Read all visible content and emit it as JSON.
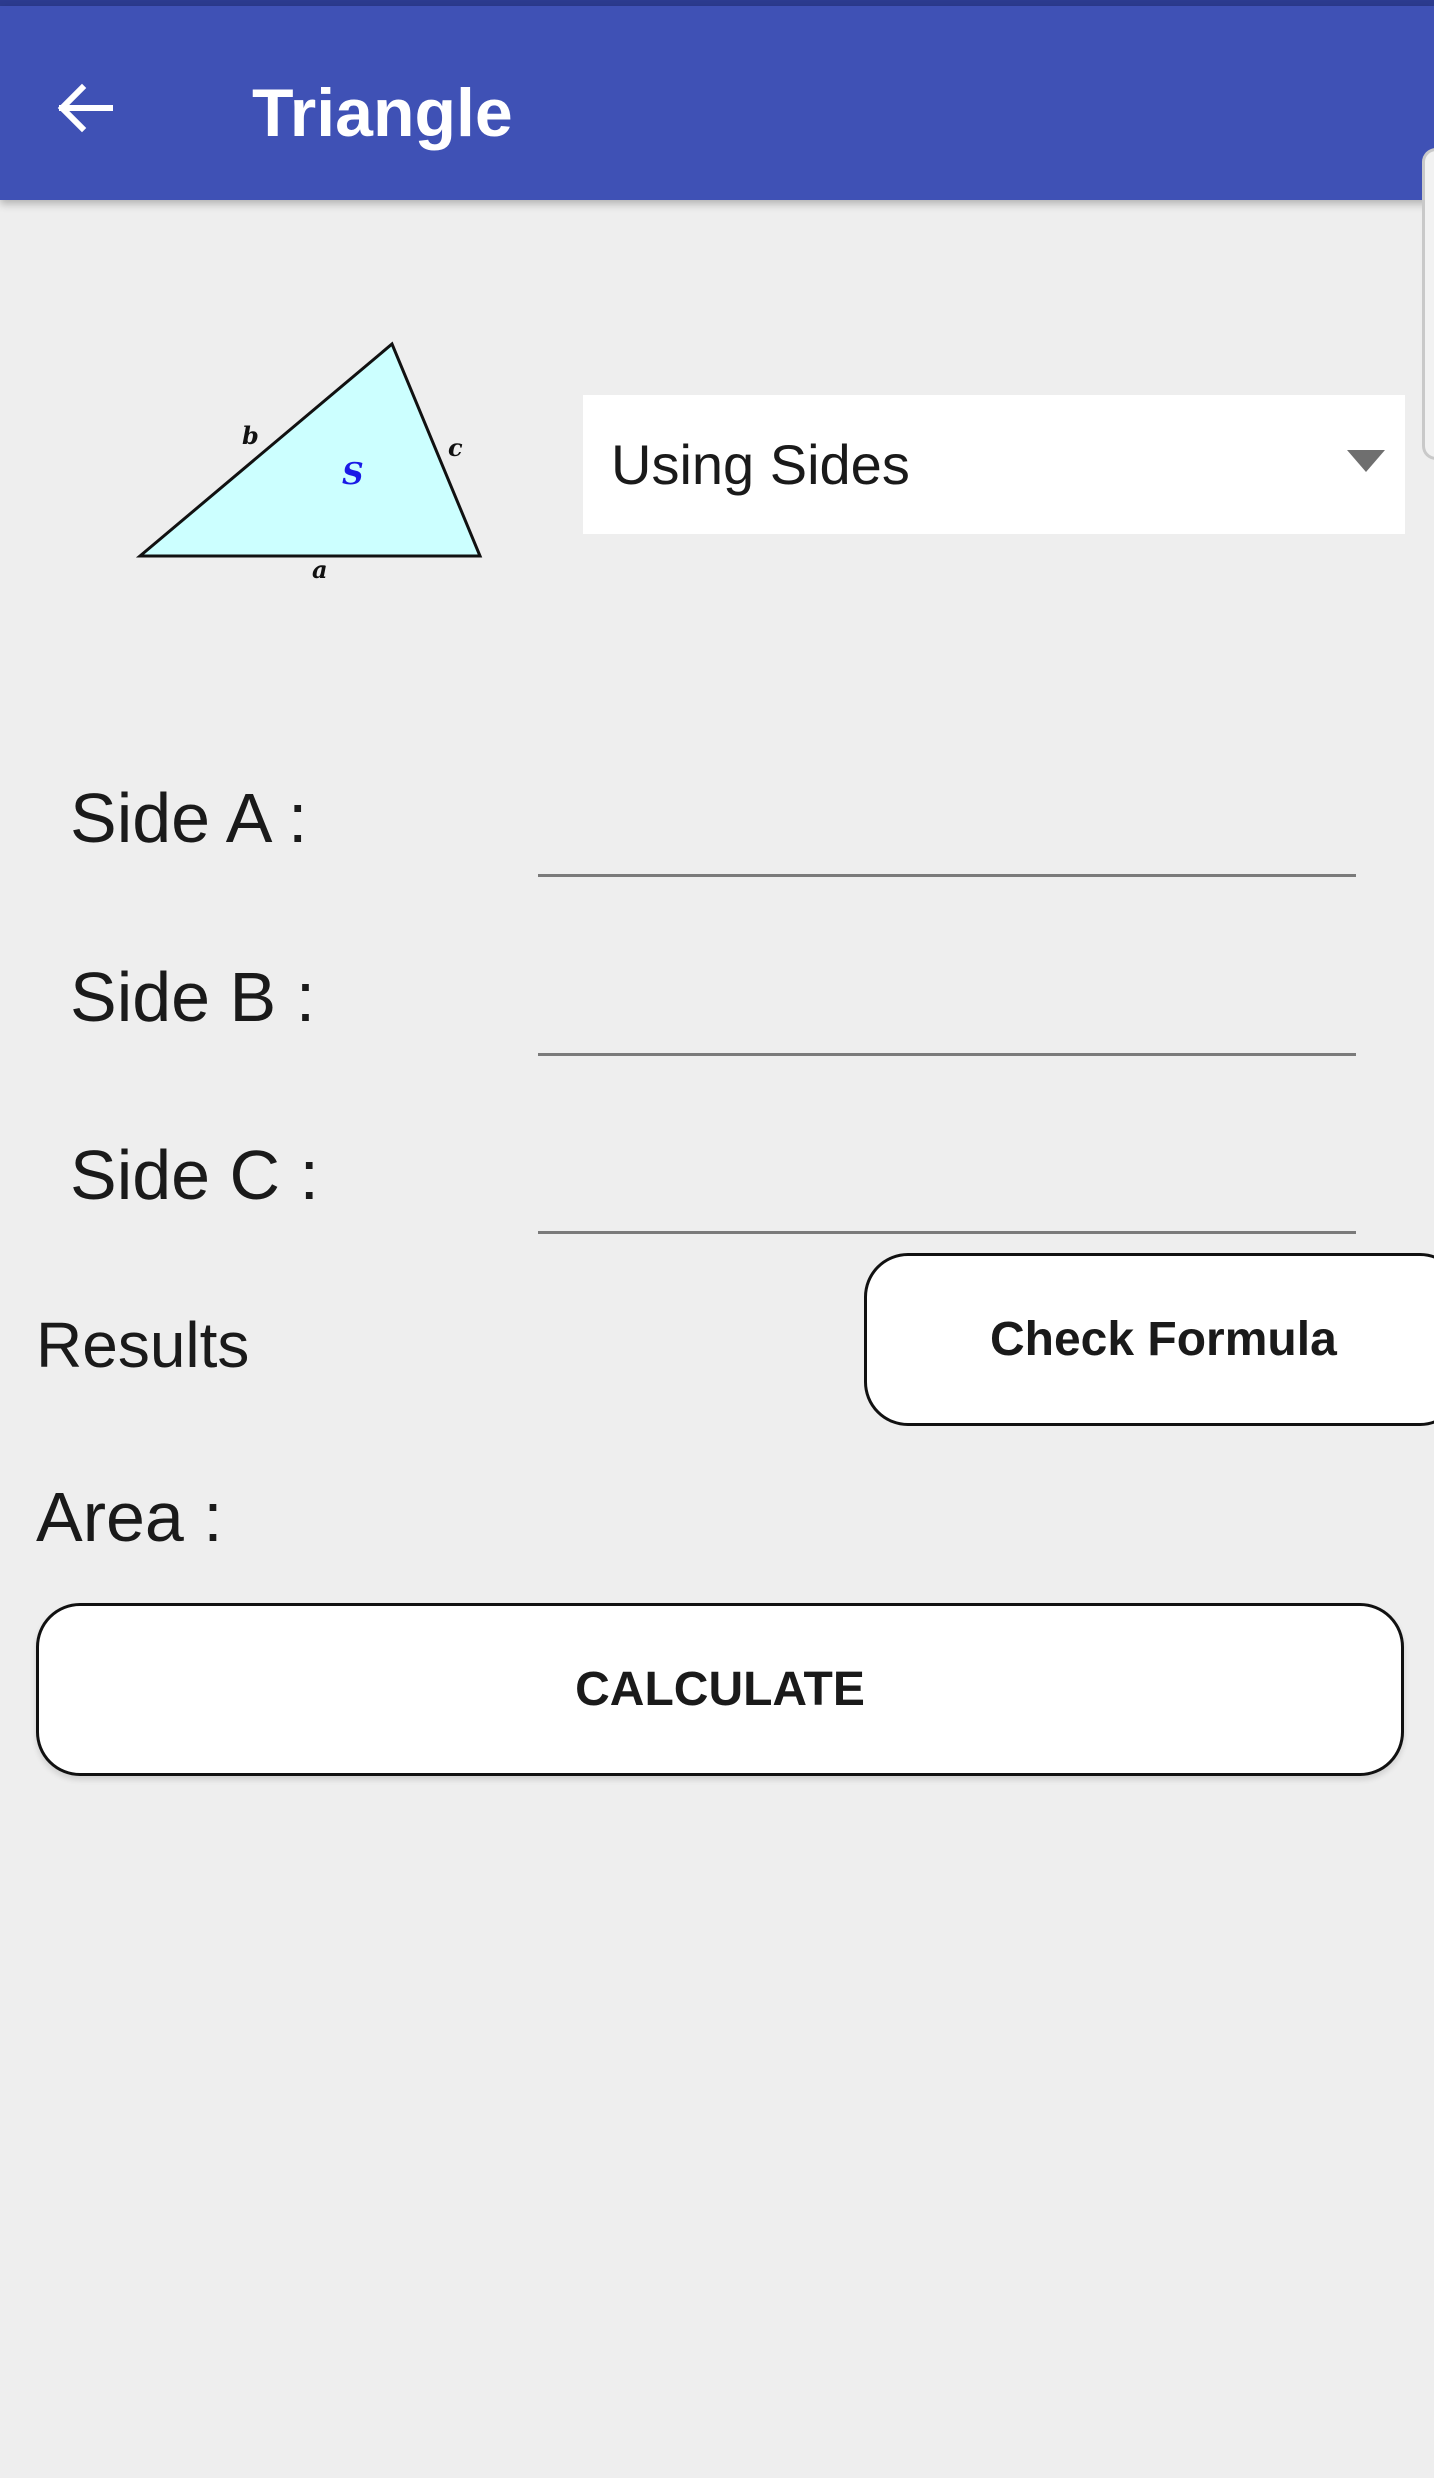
{
  "appbar": {
    "title": "Triangle"
  },
  "diagram": {
    "side_a": "a",
    "side_b": "b",
    "side_c": "c",
    "area": "S"
  },
  "mode_select": {
    "selected": "Using Sides"
  },
  "fields": [
    {
      "label": "Side A :",
      "value": ""
    },
    {
      "label": "Side B :",
      "value": ""
    },
    {
      "label": "Side C :",
      "value": ""
    }
  ],
  "results": {
    "label": "Results",
    "check_formula_label": "Check Formula",
    "area_label": "Area :"
  },
  "actions": {
    "calculate_label": "CALCULATE"
  },
  "colors": {
    "appbar": "#3f51b5",
    "background": "#eeeeee",
    "triangle_fill": "#ccffff",
    "area_symbol": "#1a1ae6"
  }
}
